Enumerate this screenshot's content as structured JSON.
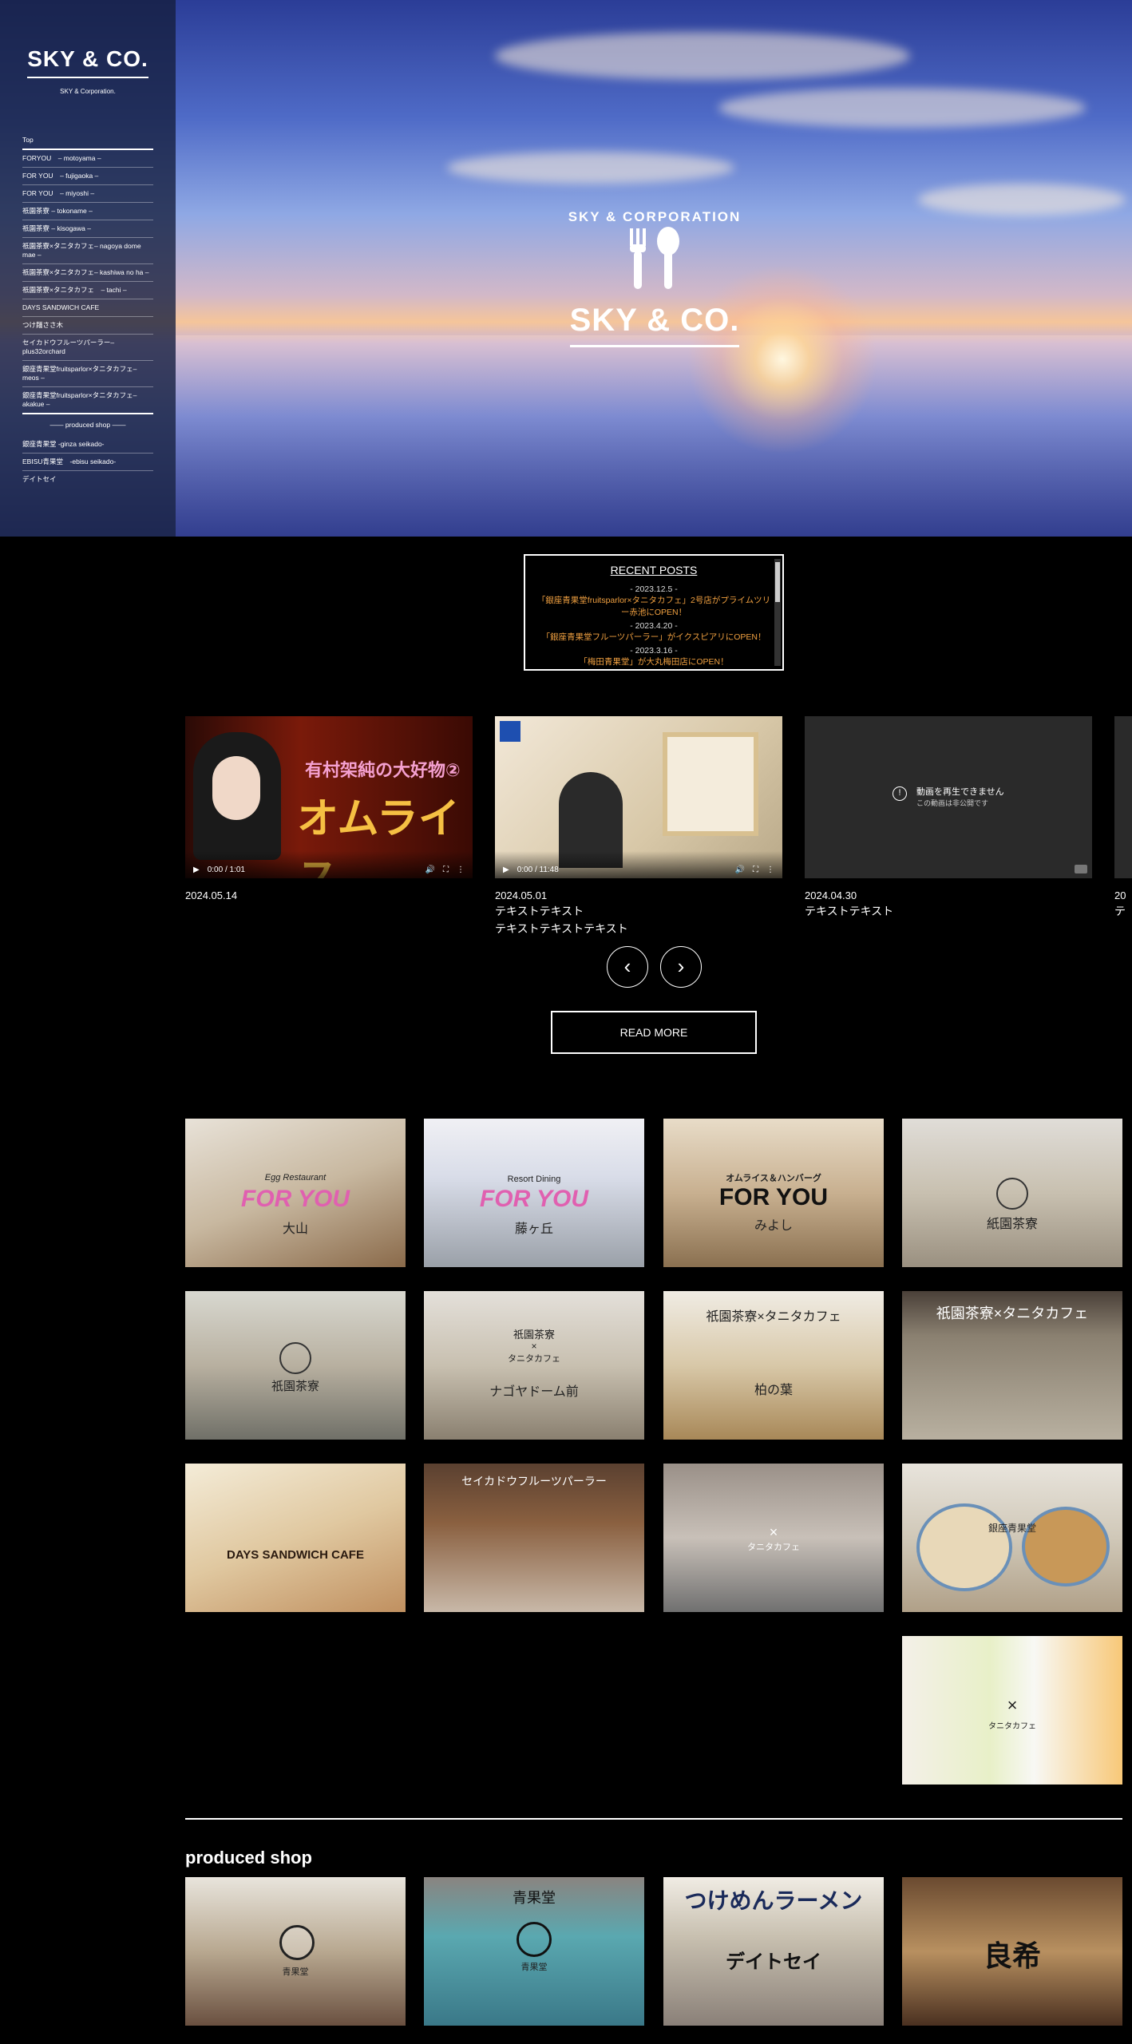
{
  "brand": {
    "logo": "SKY & CO.",
    "subtitle": "SKY & Corporation."
  },
  "nav": [
    "Top",
    "FORYOU　– motoyama –",
    "FOR YOU　– fujigaoka –",
    "FOR YOU　– miyoshi –",
    "祇園茶寮 – tokoname –",
    "祇園茶寮 – kisogawa –",
    "祇園茶寮×タニタカフェ– nagoya dome mae –",
    "祇園茶寮×タニタカフェ– kashiwa no ha –",
    "祇園茶寮×タニタカフェ　– tachi –",
    "DAYS SANDWICH CAFE",
    "つけ麺ささ木",
    "セイカドウフルーツパーラー– plus32orchard",
    "銀座青果堂fruitsparlor×タニタカフェ– meos –",
    "銀座青果堂fruitsparlor×タニタカフェ– akakue –"
  ],
  "nav_section": "produced shop",
  "nav_produced": [
    "銀座青果堂 -ginza seikado-",
    "EBISU青果堂　-ebisu seikado-",
    "デイトセイ"
  ],
  "hero": {
    "arc_text": "SKY & CORPORATION",
    "name": "SKY & CO."
  },
  "recent": {
    "title": "RECENT POSTS",
    "posts": [
      {
        "date": "- 2023.12.5 -",
        "text": "「銀座青果堂fruitsparlor×タニタカフェ」2号店がプライムツリー赤池にOPEN！"
      },
      {
        "date": "- 2023.4.20 -",
        "text": "「銀座青果堂フルーツパーラー」がイクスピアリにOPEN！"
      },
      {
        "date": "- 2023.3.16 -",
        "text": "「梅田青果堂」が大丸梅田店にOPEN！"
      }
    ]
  },
  "videos": [
    {
      "date": "2024.05.14",
      "text1": "",
      "text2": "",
      "time": "0:00 / 1:01",
      "overlay": "有村架純の大好物②",
      "title_big": "オムライス"
    },
    {
      "date": "2024.05.01",
      "text1": "テキストテキスト",
      "text2": "テキストテキストテキスト",
      "time": "0:00 / 11:48",
      "overlay": "",
      "title_big": ""
    },
    {
      "date": "2024.04.30",
      "text1": "テキストテキスト",
      "text2": "",
      "time": "",
      "overlay": "",
      "title_big": "",
      "error1": "動画を再生できません",
      "error2": "この動画は非公開です"
    },
    {
      "date": "20",
      "text1": "テ",
      "text2": "",
      "time": "",
      "overlay": "",
      "title_big": ""
    }
  ],
  "read_more": "READ MORE",
  "produced_title": "produced shop",
  "tiles": {
    "t1": {
      "a": "Egg Restaurant",
      "b": "FOR YOU",
      "c": "大山"
    },
    "t2": {
      "a": "Resort Dining",
      "b": "FOR YOU",
      "c": "藤ヶ丘"
    },
    "t3": {
      "a": "オムライス＆ハンバーグ",
      "b": "FOR YOU",
      "c": "みよし"
    },
    "t4": {
      "a": "紙園茶寮"
    },
    "t5": {
      "a": "祇園茶寮"
    },
    "t6": {
      "a": "祇園茶寮",
      "b": "×",
      "c": "タニタカフェ",
      "d": "ナゴヤドーム前"
    },
    "t7": {
      "a": "祇園茶寮×タニタカフェ",
      "b": "柏の葉"
    },
    "t8": {
      "a": "祇園茶寮×タニタカフェ"
    },
    "t9": {
      "a": "DAYS SANDWICH CAFE"
    },
    "t10": {
      "a": "セイカドウフルーツパーラー"
    },
    "t11": {
      "a": "×",
      "b": "タニタカフェ"
    },
    "t12": {
      "a": "銀座青果堂"
    },
    "t13": {
      "a": "×",
      "b": "タニタカフェ"
    },
    "p1": {
      "a": "青果堂"
    },
    "p2": {
      "a": "青果堂"
    },
    "p3": {
      "a": "つけめんラーメン",
      "b": "デイトセイ"
    },
    "p4": {
      "a": "良希"
    }
  }
}
